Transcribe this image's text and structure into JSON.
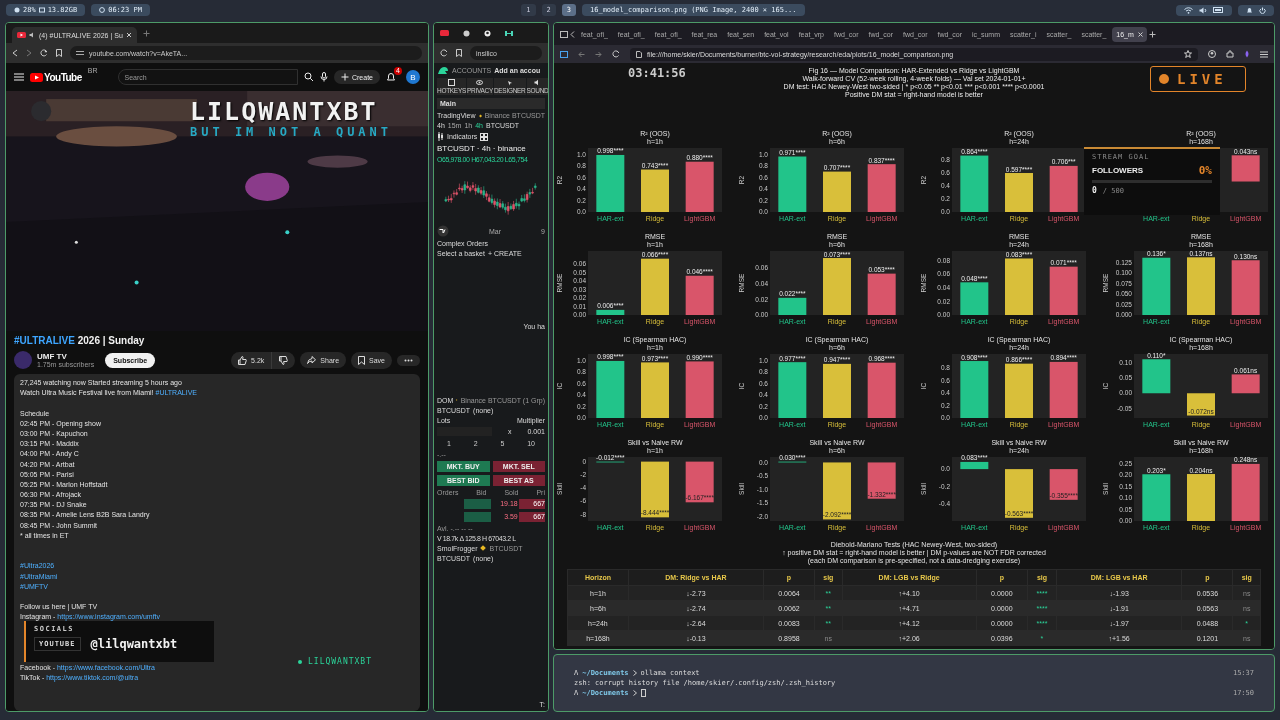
{
  "top_bar": {
    "stats": [
      "28%",
      "13.82GB"
    ],
    "clock": "06:23 PM",
    "workspaces": [
      {
        "label": "1",
        "selected": false
      },
      {
        "label": "2",
        "selected": false
      },
      {
        "label": "3",
        "selected": true
      }
    ],
    "window_title": "16_model_comparison.png (PNG Image, 2400 × 165..."
  },
  "youtube_window": {
    "tab": "(4) #ULTRALIVE 2026 | Su",
    "url": "youtube.com/watch?v=AkeTA...",
    "header": {
      "logo": "YouTube",
      "region": "BR",
      "search_placeholder": "Search",
      "create": "Create",
      "notifications": "4",
      "avatar": "B"
    },
    "title_hashtag": "#ULTRALIVE",
    "title_rest": "2026 | Sunday",
    "channel": "UMF TV",
    "subscribers": "1.75m subscribers",
    "subscribe": "Subscribe",
    "likes": "5.2k",
    "share": "Share",
    "save": "Save",
    "description": [
      {
        "kind": "text",
        "text": "27,245 watching now  Started streaming 5 hours ago"
      },
      {
        "kind": "text",
        "text": "Watch Ultra Music Festival live from Miami! ",
        "link": "#ULTRALIVE"
      },
      {
        "kind": "blank"
      },
      {
        "kind": "text",
        "text": "Schedule"
      },
      {
        "kind": "text",
        "text": "02:45 PM - Opening show"
      },
      {
        "kind": "text",
        "text": "03:00 PM - Kapuchon"
      },
      {
        "kind": "text",
        "text": "03:15 PM - Maddix"
      },
      {
        "kind": "text",
        "text": "04:00 PM - Andy C"
      },
      {
        "kind": "text",
        "text": "04:20 PM - Artbat"
      },
      {
        "kind": "text",
        "text": "05:05 PM - Parisi"
      },
      {
        "kind": "text",
        "text": "05:25 PM - Marlon Hoffstadt"
      },
      {
        "kind": "text",
        "text": "06:30 PM - Afrojack"
      },
      {
        "kind": "text",
        "text": "07:35 PM - DJ Snake"
      },
      {
        "kind": "text",
        "text": "08:35 PM - Amelie Lens B2B Sara Landry"
      },
      {
        "kind": "text",
        "text": "08:45 PM - John Summit"
      },
      {
        "kind": "text",
        "text": "* all times in ET"
      },
      {
        "kind": "blank"
      },
      {
        "kind": "blank"
      },
      {
        "kind": "text",
        "link": "#Ultra2026"
      },
      {
        "kind": "text",
        "link": "#UltraMiami"
      },
      {
        "kind": "text",
        "link": "#UMFTV"
      },
      {
        "kind": "blank"
      },
      {
        "kind": "text",
        "text": "Follow us here | UMF TV"
      },
      {
        "kind": "text",
        "text": "Instagram - ",
        "link": "https://www.instagram.com/umftv"
      },
      {
        "kind": "blank"
      },
      {
        "kind": "blank"
      },
      {
        "kind": "blank"
      },
      {
        "kind": "blank"
      },
      {
        "kind": "text",
        "text": "Facebook - ",
        "link": "https://www.facebook.com/Ultra"
      },
      {
        "kind": "text",
        "text": "TikTok - ",
        "link": "https://www.tiktok.com/@ultra"
      }
    ]
  },
  "trading_window": {
    "url": "insilico",
    "accounts": "ACCOUNTS",
    "add_account": "Add an accou",
    "tools": [
      "HOTKEYS",
      "PRIVACY",
      "DESIGNER",
      "SOUND"
    ],
    "layout": "Main",
    "widget": "TradingView",
    "source": "Binance BTCUSDT",
    "interval": "4h",
    "intervals": [
      {
        "label": "15m",
        "selected": false
      },
      {
        "label": "1h",
        "selected": false
      },
      {
        "label": "4h",
        "selected": true
      }
    ],
    "symbol_short": "BTCUSDT",
    "indicators": "Indicators",
    "symbol": "BTCUSDT · 4h · binance",
    "ohlc": "O65,978.00 H67,043.20 L65,754",
    "axis": [
      "Mar",
      "9"
    ],
    "complex_orders": "Complex Orders",
    "basket": "Select a basket",
    "create": "+ CREATE",
    "empty": "You ha",
    "dom": {
      "title": "DOM",
      "source": "Binance BTCUSDT (1 Grp)",
      "symbol": "BTCUSDT",
      "account": "(none)",
      "lots": "Lots",
      "multiplier_label": "Multiplier",
      "times": "x",
      "multiplier": "0.001",
      "sizes": [
        "1",
        "2",
        "5",
        "10"
      ],
      "price": "-.--",
      "buy": "MKT. BUY",
      "sell": "MKT. SEL",
      "bid": "BEST BID",
      "ask": "BEST AS",
      "columns": [
        "Orders",
        "Bid",
        "Sold",
        "Pri"
      ],
      "rows": [
        [
          "19.18",
          "667"
        ],
        [
          "3.59",
          "667"
        ]
      ],
      "avl": "Avl. -.-- -- --",
      "stats": "V 18.7k Δ 125.8 H 67043.2 L"
    },
    "footer_widget": "SmolFrogger",
    "footer_source": "BTCUSDT",
    "footer_symbol": "BTCUSDT",
    "footer_account": "(none)",
    "footer_tab": "T:"
  },
  "image_window": {
    "tabs": [
      {
        "label": "feat_ofi_",
        "selected": false
      },
      {
        "label": "feat_ofi_",
        "selected": false
      },
      {
        "label": "feat_ofi_",
        "selected": false
      },
      {
        "label": "feat_rea",
        "selected": false
      },
      {
        "label": "feat_sen",
        "selected": false
      },
      {
        "label": "feat_vol",
        "selected": false
      },
      {
        "label": "feat_vrp",
        "selected": false
      },
      {
        "label": "fwd_cor",
        "selected": false
      },
      {
        "label": "fwd_cor",
        "selected": false
      },
      {
        "label": "fwd_cor",
        "selected": false
      },
      {
        "label": "fwd_cor",
        "selected": false
      },
      {
        "label": "ic_summ",
        "selected": false
      },
      {
        "label": "scatter_i",
        "selected": false
      },
      {
        "label": "scatter_",
        "selected": false
      },
      {
        "label": "scatter_",
        "selected": false
      },
      {
        "label": "16_m",
        "selected": true
      }
    ],
    "url": "file:///home/skier/Documents/burner/btc-vol-strategy/research/eda/plots/16_model_comparison.png",
    "figure_title": [
      "Fig 16 — Model Comparison: HAR-Extended vs Ridge vs LightGBM",
      "Walk-forward CV (52-week rolling, 4-week folds) — Val set 2024-01-01+",
      "DM test: HAC Newey-West two-sided  |  * p<0.05  ** p<0.01  *** p<0.001  **** p<0.0001",
      "Positive DM stat = right-hand model is better"
    ],
    "models": [
      {
        "color": "#22c48a"
      },
      {
        "color": "#d9bf3a"
      },
      {
        "color": "#d9556a"
      }
    ],
    "charts": [
      {
        "horizon": "h=1h",
        "chart_data": {
          "type": "bar",
          "title": "R² (OOS)",
          "ylabel": "R2",
          "categories": [
            "HAR-ext",
            "Ridge",
            "LightGBM"
          ],
          "values": [
            0.998,
            0.743,
            0.88
          ],
          "value_labels": [
            "0.998****",
            "0.743****",
            "0.880****"
          ],
          "ylim": [
            0,
            1.12
          ],
          "yticks": [
            {
              "value": 0,
              "label": "0.0"
            },
            {
              "value": 0.2,
              "label": "0.2"
            },
            {
              "value": 0.4,
              "label": "0.4"
            },
            {
              "value": 0.6,
              "label": "0.6"
            },
            {
              "value": 0.8,
              "label": "0.8"
            },
            {
              "value": 1,
              "label": "1.0"
            }
          ]
        }
      },
      {
        "horizon": "h=6h",
        "chart_data": {
          "type": "bar",
          "title": "R² (OOS)",
          "ylabel": "R2",
          "categories": [
            "HAR-ext",
            "Ridge",
            "LightGBM"
          ],
          "values": [
            0.971,
            0.707,
            0.837
          ],
          "value_labels": [
            "0.971****",
            "0.707****",
            "0.837****"
          ],
          "ylim": [
            0,
            1.12
          ],
          "yticks": [
            {
              "value": 0,
              "label": "0.0"
            },
            {
              "value": 0.2,
              "label": "0.2"
            },
            {
              "value": 0.4,
              "label": "0.4"
            },
            {
              "value": 0.6,
              "label": "0.6"
            },
            {
              "value": 0.8,
              "label": "0.8"
            },
            {
              "value": 1,
              "label": "1.0"
            }
          ]
        }
      },
      {
        "horizon": "h=24h",
        "chart_data": {
          "type": "bar",
          "title": "R² (OOS)",
          "ylabel": "R2",
          "categories": [
            "HAR-ext",
            "Ridge",
            "LightGBM"
          ],
          "values": [
            0.864,
            0.597,
            0.706
          ],
          "value_labels": [
            "0.864****",
            "0.597****",
            "0.706***"
          ],
          "ylim": [
            0,
            0.98
          ],
          "yticks": [
            {
              "value": 0,
              "label": "0.0"
            },
            {
              "value": 0.2,
              "label": "0.2"
            },
            {
              "value": 0.4,
              "label": "0.4"
            },
            {
              "value": 0.6,
              "label": "0.6"
            },
            {
              "value": 0.8,
              "label": "0.8"
            }
          ]
        }
      },
      {
        "horizon": "h=168h",
        "chart_data": {
          "type": "bar",
          "title": "R² (OOS)",
          "categories": [
            "HAR-ext",
            "Ridge",
            "LightGBM"
          ],
          "values": [
            null,
            null,
            0.043
          ],
          "value_labels": [
            null,
            null,
            "0.043ns"
          ],
          "ylim": [
            -0.05,
            0.055
          ]
        }
      },
      {
        "horizon": "h=1h",
        "chart_data": {
          "type": "bar",
          "title": "RMSE",
          "ylabel": "RMSE",
          "categories": [
            "HAR-ext",
            "Ridge",
            "LightGBM"
          ],
          "values": [
            0.006,
            0.066,
            0.046
          ],
          "value_labels": [
            "0.006****",
            "0.066****",
            "0.046****"
          ],
          "ylim": [
            0,
            0.075
          ],
          "yticks": [
            {
              "value": 0,
              "label": "0.00"
            },
            {
              "value": 0.01,
              "label": "0.01"
            },
            {
              "value": 0.02,
              "label": "0.02"
            },
            {
              "value": 0.03,
              "label": "0.03"
            },
            {
              "value": 0.04,
              "label": "0.04"
            },
            {
              "value": 0.05,
              "label": "0.05"
            },
            {
              "value": 0.06,
              "label": "0.06"
            }
          ]
        }
      },
      {
        "horizon": "h=6h",
        "chart_data": {
          "type": "bar",
          "title": "RMSE",
          "ylabel": "RMSE",
          "categories": [
            "HAR-ext",
            "Ridge",
            "LightGBM"
          ],
          "values": [
            0.022,
            0.073,
            0.053
          ],
          "value_labels": [
            "0.022****",
            "0.073****",
            "0.053****"
          ],
          "ylim": [
            0,
            0.082
          ],
          "yticks": [
            {
              "value": 0,
              "label": "0.00"
            },
            {
              "value": 0.02,
              "label": "0.02"
            },
            {
              "value": 0.04,
              "label": "0.04"
            },
            {
              "value": 0.06,
              "label": "0.06"
            }
          ]
        }
      },
      {
        "horizon": "h=24h",
        "chart_data": {
          "type": "bar",
          "title": "RMSE",
          "ylabel": "RMSE",
          "categories": [
            "HAR-ext",
            "Ridge",
            "LightGBM"
          ],
          "values": [
            0.048,
            0.083,
            0.071
          ],
          "value_labels": [
            "0.048****",
            "0.083****",
            "0.071****"
          ],
          "ylim": [
            0,
            0.094
          ],
          "yticks": [
            {
              "value": 0,
              "label": "0.00"
            },
            {
              "value": 0.02,
              "label": "0.02"
            },
            {
              "value": 0.04,
              "label": "0.04"
            },
            {
              "value": 0.06,
              "label": "0.06"
            },
            {
              "value": 0.08,
              "label": "0.08"
            }
          ]
        }
      },
      {
        "horizon": "h=168h",
        "chart_data": {
          "type": "bar",
          "title": "RMSE",
          "ylabel": "RMSE",
          "categories": [
            "HAR-ext",
            "Ridge",
            "LightGBM"
          ],
          "values": [
            0.136,
            0.137,
            0.13
          ],
          "value_labels": [
            "0.136*",
            "0.137ns",
            "0.130ns"
          ],
          "ylim": [
            0,
            0.152
          ],
          "yticks": [
            {
              "value": 0,
              "label": "0.000"
            },
            {
              "value": 0.025,
              "label": "0.025"
            },
            {
              "value": 0.05,
              "label": "0.050"
            },
            {
              "value": 0.075,
              "label": "0.075"
            },
            {
              "value": 0.1,
              "label": "0.100"
            },
            {
              "value": 0.125,
              "label": "0.125"
            }
          ]
        }
      },
      {
        "horizon": "h=1h",
        "chart_data": {
          "type": "bar",
          "title": "IC (Spearman HAC)",
          "ylabel": "IC",
          "categories": [
            "HAR-ext",
            "Ridge",
            "LightGBM"
          ],
          "values": [
            0.998,
            0.973,
            0.99
          ],
          "value_labels": [
            "0.998****",
            "0.973****",
            "0.990****"
          ],
          "ylim": [
            0,
            1.12
          ],
          "yticks": [
            {
              "value": 0,
              "label": "0.0"
            },
            {
              "value": 0.2,
              "label": "0.2"
            },
            {
              "value": 0.4,
              "label": "0.4"
            },
            {
              "value": 0.6,
              "label": "0.6"
            },
            {
              "value": 0.8,
              "label": "0.8"
            },
            {
              "value": 1,
              "label": "1.0"
            }
          ]
        }
      },
      {
        "horizon": "h=6h",
        "chart_data": {
          "type": "bar",
          "title": "IC (Spearman HAC)",
          "ylabel": "IC",
          "categories": [
            "HAR-ext",
            "Ridge",
            "LightGBM"
          ],
          "values": [
            0.977,
            0.947,
            0.968
          ],
          "value_labels": [
            "0.977****",
            "0.947****",
            "0.968****"
          ],
          "ylim": [
            0,
            1.12
          ],
          "yticks": [
            {
              "value": 0,
              "label": "0.0"
            },
            {
              "value": 0.2,
              "label": "0.2"
            },
            {
              "value": 0.4,
              "label": "0.4"
            },
            {
              "value": 0.6,
              "label": "0.6"
            },
            {
              "value": 0.8,
              "label": "0.8"
            },
            {
              "value": 1,
              "label": "1.0"
            }
          ]
        }
      },
      {
        "horizon": "h=24h",
        "chart_data": {
          "type": "bar",
          "title": "IC (Spearman HAC)",
          "ylabel": "IC",
          "categories": [
            "HAR-ext",
            "Ridge",
            "LightGBM"
          ],
          "values": [
            0.908,
            0.866,
            0.894
          ],
          "value_labels": [
            "0.908****",
            "0.866****",
            "0.894****"
          ],
          "ylim": [
            0,
            1.02
          ],
          "yticks": [
            {
              "value": 0,
              "label": "0.0"
            },
            {
              "value": 0.2,
              "label": "0.2"
            },
            {
              "value": 0.4,
              "label": "0.4"
            },
            {
              "value": 0.6,
              "label": "0.6"
            },
            {
              "value": 0.8,
              "label": "0.8"
            }
          ]
        }
      },
      {
        "horizon": "h=168h",
        "chart_data": {
          "type": "bar",
          "title": "IC (Spearman HAC)",
          "ylabel": "IC",
          "categories": [
            "HAR-ext",
            "Ridge",
            "LightGBM"
          ],
          "values": [
            0.11,
            -0.072,
            0.061
          ],
          "value_labels": [
            "0.110*",
            "-0.072ns",
            "0.061ns"
          ],
          "ylim": [
            -0.08,
            0.127
          ],
          "yticks": [
            {
              "value": -0.05,
              "label": "-0.05"
            },
            {
              "value": 0,
              "label": "0.00"
            },
            {
              "value": 0.05,
              "label": "0.05"
            },
            {
              "value": 0.1,
              "label": "0.10"
            }
          ]
        }
      },
      {
        "horizon": "h=1h",
        "chart_data": {
          "type": "bar",
          "title": "Skill vs Naive RW",
          "ylabel": "Skill",
          "categories": [
            "HAR-ext",
            "Ridge",
            "LightGBM"
          ],
          "values": [
            -0.012,
            -8.444,
            -6.167
          ],
          "value_labels": [
            "-0.012****",
            "-8.444****",
            "-6.167****"
          ],
          "ylim": [
            -9,
            0.7
          ],
          "yticks": [
            {
              "value": -8,
              "label": "-8"
            },
            {
              "value": -6,
              "label": "-6"
            },
            {
              "value": -4,
              "label": "-4"
            },
            {
              "value": -2,
              "label": "-2"
            },
            {
              "value": 0,
              "label": "0"
            }
          ]
        }
      },
      {
        "horizon": "h=6h",
        "chart_data": {
          "type": "bar",
          "title": "Skill vs Naive RW",
          "ylabel": "Skill",
          "categories": [
            "HAR-ext",
            "Ridge",
            "LightGBM"
          ],
          "values": [
            0.03,
            -2.092,
            -1.332
          ],
          "value_labels": [
            "0.030****",
            "-2.092****",
            "-1.332****"
          ],
          "ylim": [
            -2.15,
            0.2
          ],
          "yticks": [
            {
              "value": -2,
              "label": "-2.0"
            },
            {
              "value": -1.5,
              "label": "-1.5"
            },
            {
              "value": -1,
              "label": "-1.0"
            },
            {
              "value": -0.5,
              "label": "-0.5"
            },
            {
              "value": 0,
              "label": "0.0"
            }
          ]
        }
      },
      {
        "horizon": "h=24h",
        "chart_data": {
          "type": "bar",
          "title": "Skill vs Naive RW",
          "ylabel": "Skill",
          "categories": [
            "HAR-ext",
            "Ridge",
            "LightGBM"
          ],
          "values": [
            0.083,
            -0.563,
            -0.355
          ],
          "value_labels": [
            "0.083****",
            "-0.563****",
            "-0.355****"
          ],
          "ylim": [
            -0.6,
            0.14
          ],
          "yticks": [
            {
              "value": -0.4,
              "label": "-0.4"
            },
            {
              "value": -0.2,
              "label": "-0.2"
            },
            {
              "value": 0,
              "label": "0.0"
            }
          ]
        }
      },
      {
        "horizon": "h=168h",
        "chart_data": {
          "type": "bar",
          "title": "Skill vs Naive RW",
          "ylabel": "Skill",
          "categories": [
            "HAR-ext",
            "Ridge",
            "LightGBM"
          ],
          "values": [
            0.203,
            0.204,
            0.248
          ],
          "value_labels": [
            "0.203*",
            "0.204ns",
            "0.248ns"
          ],
          "ylim": [
            0,
            0.278
          ],
          "yticks": [
            {
              "value": 0,
              "label": "0.00"
            },
            {
              "value": 0.05,
              "label": "0.05"
            },
            {
              "value": 0.1,
              "label": "0.10"
            },
            {
              "value": 0.15,
              "label": "0.15"
            },
            {
              "value": 0.2,
              "label": "0.20"
            },
            {
              "value": 0.25,
              "label": "0.25"
            }
          ]
        }
      }
    ],
    "dm_caption": [
      "Diebold-Mariano Tests (HAC Newey-West, two-sided)",
      "↑ positive DM stat = right-hand model is better   |   DM p-values are NOT FDR corrected",
      "(each DM comparison is pre-specified, not a data-dredging exercise)"
    ],
    "table": {
      "columns": [
        "Horizon",
        "DM: Ridge vs HAR",
        "p",
        "sig",
        "DM: LGB vs Ridge",
        "p",
        "sig",
        "DM: LGB vs HAR",
        "p",
        "sig"
      ],
      "rows": [
        [
          "h=1h",
          "↓-2.73",
          "0.0064",
          {
            "text": "**",
            "significant": true
          },
          "↑+4.10",
          "0.0000",
          {
            "text": "****",
            "significant": true
          },
          "↓-1.93",
          "0.0536",
          {
            "text": "ns",
            "significant": false
          }
        ],
        [
          "h=6h",
          "↓-2.74",
          "0.0062",
          {
            "text": "**",
            "significant": true
          },
          "↑+4.71",
          "0.0000",
          {
            "text": "****",
            "significant": true
          },
          "↓-1.91",
          "0.0563",
          {
            "text": "ns",
            "significant": false
          }
        ],
        [
          "h=24h",
          "↓-2.64",
          "0.0083",
          {
            "text": "**",
            "significant": true
          },
          "↑+4.12",
          "0.0000",
          {
            "text": "****",
            "significant": true
          },
          "↓-1.97",
          "0.0488",
          {
            "text": "*",
            "significant": true
          }
        ],
        [
          "h=168h",
          "↓-0.13",
          "0.8958",
          {
            "text": "ns",
            "significant": false
          },
          "↑+2.06",
          "0.0396",
          {
            "text": "*",
            "significant": true
          },
          "↑+1.56",
          "0.1201",
          {
            "text": "ns",
            "significant": false
          }
        ]
      ]
    }
  },
  "terminal": {
    "lines": [
      {
        "prompt": "Λ",
        "path": "~/Documents",
        "command": "ollama context",
        "time": "15:37"
      },
      {
        "output": "zsh: corrupt history file /home/skier/.config/zsh/.zsh_history"
      },
      {
        "prompt": "Λ",
        "path": "~/Documents",
        "cursor": true,
        "time": "17:50"
      }
    ]
  },
  "overlays": {
    "logo": "LILQWANTXBT",
    "tagline": "BUT IM NOT A QUANT",
    "timer": "03:41:56",
    "live": "LIVE",
    "goal": {
      "caption": "STREAM GOAL",
      "title": "FOLLOWERS",
      "percent": "0%",
      "count": "0",
      "target": "/ 500",
      "level": 0
    },
    "socials": {
      "caption": "SOCIALS",
      "platform": "YOUTUBE",
      "handle": "@lilqwantxbt"
    },
    "handle_tag": "LILQWANTXBT"
  }
}
